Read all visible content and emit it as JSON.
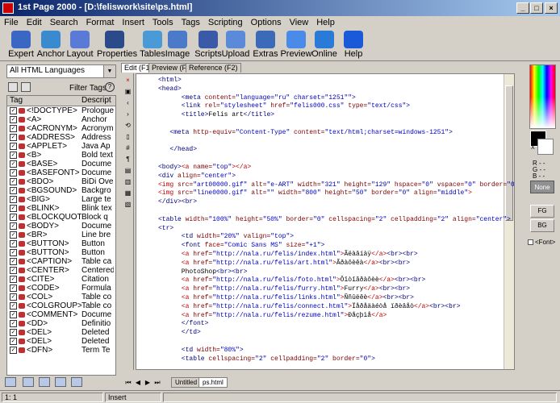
{
  "window": {
    "title": "1st Page 2000 - [D:\\feliswork\\site\\ps.html]",
    "buttons": [
      "_",
      "□",
      "×"
    ]
  },
  "menu": [
    "File",
    "Edit",
    "Search",
    "Format",
    "Insert",
    "Tools",
    "Tags",
    "Scripting",
    "Options",
    "View",
    "Help"
  ],
  "toolbar": [
    {
      "label": "Expert",
      "icon": "expert-icon",
      "color": "#3a66c4"
    },
    {
      "label": "Anchor",
      "icon": "anchor-icon",
      "color": "#3a8ad0"
    },
    {
      "label": "Layout",
      "icon": "layout-icon",
      "color": "#5a7ad8"
    },
    {
      "label": "Properties",
      "icon": "properties-icon",
      "color": "#2a4a8a"
    },
    {
      "label": "Tables",
      "icon": "tables-icon",
      "color": "#4a9ad8"
    },
    {
      "label": "Image",
      "icon": "image-icon",
      "color": "#4a7ac8"
    },
    {
      "label": "Scripts",
      "icon": "scripts-icon",
      "color": "#3a5aa8"
    },
    {
      "label": "Upload",
      "icon": "upload-icon",
      "color": "#5a8ad8"
    },
    {
      "label": "Extras",
      "icon": "extras-icon",
      "color": "#3a6ab8"
    },
    {
      "label": "Preview",
      "icon": "preview-icon",
      "color": "#4a8ae8"
    },
    {
      "label": "Online",
      "icon": "online-icon",
      "color": "#2a7ad8"
    },
    {
      "label": "Help",
      "icon": "help-icon",
      "color": "#1a5ad8"
    }
  ],
  "left": {
    "language_select": "All HTML Languages",
    "filter_label": "Filter Tags",
    "help": "?",
    "columns": [
      "Tag",
      "Descript"
    ],
    "tags": [
      {
        "tag": "<!DOCTYPE>",
        "desc": "Prologue"
      },
      {
        "tag": "<A>",
        "desc": "Anchor"
      },
      {
        "tag": "<ACRONYM>",
        "desc": "Acronym"
      },
      {
        "tag": "<ADDRESS>",
        "desc": "Address"
      },
      {
        "tag": "<APPLET>",
        "desc": "Java Ap"
      },
      {
        "tag": "<B>",
        "desc": "Bold text"
      },
      {
        "tag": "<BASE>",
        "desc": "Docume"
      },
      {
        "tag": "<BASEFONT>",
        "desc": "Docume"
      },
      {
        "tag": "<BDO>",
        "desc": "BiDi Ove"
      },
      {
        "tag": "<BGSOUND>",
        "desc": "Backgro"
      },
      {
        "tag": "<BIG>",
        "desc": "Large te"
      },
      {
        "tag": "<BLINK>",
        "desc": "Blink tex"
      },
      {
        "tag": "<BLOCKQUOTE>",
        "desc": "Block q"
      },
      {
        "tag": "<BODY>",
        "desc": "Docume"
      },
      {
        "tag": "<BR>",
        "desc": "Line bre"
      },
      {
        "tag": "<BUTTON>",
        "desc": "Button"
      },
      {
        "tag": "<BUTTON>",
        "desc": "Button"
      },
      {
        "tag": "<CAPTION>",
        "desc": "Table ca"
      },
      {
        "tag": "<CENTER>",
        "desc": "Centered"
      },
      {
        "tag": "<CITE>",
        "desc": "Citation"
      },
      {
        "tag": "<CODE>",
        "desc": "Formula"
      },
      {
        "tag": "<COL>",
        "desc": "Table co"
      },
      {
        "tag": "<COLGROUP>",
        "desc": "Table co"
      },
      {
        "tag": "<COMMENT>",
        "desc": "Docume"
      },
      {
        "tag": "<DD>",
        "desc": "Definitio"
      },
      {
        "tag": "<DEL>",
        "desc": "Deleted"
      },
      {
        "tag": "<DEL>",
        "desc": "Deleted"
      },
      {
        "tag": "<DFN>",
        "desc": "Term Te"
      }
    ]
  },
  "editor": {
    "tabs": [
      "Edit (F11)",
      "Preview (F12)",
      "Reference (F2)"
    ],
    "doc_tabs": [
      "Untitled",
      "ps.html"
    ],
    "gutter_icons": [
      "×",
      "▣",
      "‹",
      "›",
      "⟲",
      "▯",
      "#",
      "¶",
      "▤",
      "▥",
      "▦",
      "▧"
    ],
    "lines": [
      [
        [
          "c-tag",
          "<html>"
        ]
      ],
      [
        [
          "c-tag",
          "<head>"
        ]
      ],
      [
        [
          "c-tag",
          "      <meta "
        ],
        [
          "c-attr",
          "content="
        ],
        [
          "c-val",
          "\"language=\"ru\" charset=\"1251\"\""
        ],
        [
          "c-tag",
          ">"
        ]
      ],
      [
        [
          "c-tag",
          "      <link "
        ],
        [
          "c-attr",
          "rel="
        ],
        [
          "c-val",
          "\"stylesheet\" "
        ],
        [
          "c-attr",
          "href="
        ],
        [
          "c-val",
          "\"felis000.css\" "
        ],
        [
          "c-attr",
          "type="
        ],
        [
          "c-val",
          "\"text/css\""
        ],
        [
          "c-tag",
          ">"
        ]
      ],
      [
        [
          "c-tag",
          "      <title>"
        ],
        [
          "c-txt",
          "Felis art"
        ],
        [
          "c-tag",
          "</title>"
        ]
      ],
      [
        [
          "c-txt",
          ""
        ]
      ],
      [
        [
          "c-tag",
          "   <meta "
        ],
        [
          "c-attr",
          "http-equiv="
        ],
        [
          "c-val",
          "\"Content-Type\" "
        ],
        [
          "c-attr",
          "content="
        ],
        [
          "c-val",
          "\"text/html;charset=windows-1251\""
        ],
        [
          "c-tag",
          ">"
        ]
      ],
      [
        [
          "c-txt",
          ""
        ]
      ],
      [
        [
          "c-tag",
          "   </head>"
        ]
      ],
      [
        [
          "c-txt",
          ""
        ]
      ],
      [
        [
          "c-tag",
          "<body>"
        ],
        [
          "c-red",
          "<a "
        ],
        [
          "c-attr",
          "name="
        ],
        [
          "c-val",
          "\"top\""
        ],
        [
          "c-red",
          "></a>"
        ]
      ],
      [
        [
          "c-tag",
          "<div "
        ],
        [
          "c-attr",
          "align="
        ],
        [
          "c-val",
          "\"center\""
        ],
        [
          "c-tag",
          ">"
        ]
      ],
      [
        [
          "c-red",
          "<img "
        ],
        [
          "c-attr",
          "src="
        ],
        [
          "c-val",
          "\"art00000.gif\" "
        ],
        [
          "c-attr",
          "alt="
        ],
        [
          "c-val",
          "\"e-ART\" "
        ],
        [
          "c-attr",
          "width="
        ],
        [
          "c-val",
          "\"321\" "
        ],
        [
          "c-attr",
          "height="
        ],
        [
          "c-val",
          "\"129\" "
        ],
        [
          "c-attr",
          "hspace="
        ],
        [
          "c-val",
          "\"0\" "
        ],
        [
          "c-attr",
          "vspace="
        ],
        [
          "c-val",
          "\"0\" "
        ],
        [
          "c-attr",
          "border="
        ],
        [
          "c-val",
          "\"0\""
        ]
      ],
      [
        [
          "c-red",
          "<img "
        ],
        [
          "c-attr",
          "src="
        ],
        [
          "c-val",
          "\"line0000.gif\" "
        ],
        [
          "c-attr",
          "alt="
        ],
        [
          "c-val",
          "\"\" "
        ],
        [
          "c-attr",
          "width="
        ],
        [
          "c-val",
          "\"800\" "
        ],
        [
          "c-attr",
          "height="
        ],
        [
          "c-val",
          "\"50\" "
        ],
        [
          "c-attr",
          "border="
        ],
        [
          "c-val",
          "\"0\" "
        ],
        [
          "c-attr",
          "align="
        ],
        [
          "c-val",
          "\"middle\""
        ],
        [
          "c-red",
          ">"
        ]
      ],
      [
        [
          "c-tag",
          "</div><br>"
        ]
      ],
      [
        [
          "c-txt",
          ""
        ]
      ],
      [
        [
          "c-tag",
          "<table "
        ],
        [
          "c-attr",
          "width="
        ],
        [
          "c-val",
          "\"100%\" "
        ],
        [
          "c-attr",
          "height="
        ],
        [
          "c-val",
          "\"50%\" "
        ],
        [
          "c-attr",
          "border="
        ],
        [
          "c-val",
          "\"0\" "
        ],
        [
          "c-attr",
          "cellspacing="
        ],
        [
          "c-val",
          "\"2\" "
        ],
        [
          "c-attr",
          "cellpadding="
        ],
        [
          "c-val",
          "\"2\" "
        ],
        [
          "c-attr",
          "align="
        ],
        [
          "c-val",
          "\"center\""
        ],
        [
          "c-tag",
          ">"
        ]
      ],
      [
        [
          "c-tag",
          "<tr>"
        ]
      ],
      [
        [
          "c-tag",
          "      <td "
        ],
        [
          "c-attr",
          "width="
        ],
        [
          "c-val",
          "\"20%\" "
        ],
        [
          "c-attr",
          "valign="
        ],
        [
          "c-val",
          "\"top\""
        ],
        [
          "c-tag",
          ">"
        ]
      ],
      [
        [
          "c-tag",
          "      <font "
        ],
        [
          "c-attr",
          "face="
        ],
        [
          "c-val",
          "\"Comic Sans MS\" "
        ],
        [
          "c-attr",
          "size="
        ],
        [
          "c-val",
          "\"+1\""
        ],
        [
          "c-tag",
          ">"
        ]
      ],
      [
        [
          "c-red",
          "      <a "
        ],
        [
          "c-attr",
          "href="
        ],
        [
          "c-val",
          "\"http://nala.ru/felis/index.html\""
        ],
        [
          "c-red",
          ">"
        ],
        [
          "c-txt",
          "Ãëàâíàÿ"
        ],
        [
          "c-red",
          "</a>"
        ],
        [
          "c-tag",
          "<br><br>"
        ]
      ],
      [
        [
          "c-red",
          "      <a "
        ],
        [
          "c-attr",
          "href="
        ],
        [
          "c-val",
          "\"http://nala.ru/felis/art.html\""
        ],
        [
          "c-red",
          ">"
        ],
        [
          "c-txt",
          "Ãðàôèêà"
        ],
        [
          "c-red",
          "</a>"
        ],
        [
          "c-tag",
          "<br><br>"
        ]
      ],
      [
        [
          "c-txt",
          "      PhotoShop"
        ],
        [
          "c-tag",
          "<br><br>"
        ]
      ],
      [
        [
          "c-red",
          "      <a "
        ],
        [
          "c-attr",
          "href="
        ],
        [
          "c-val",
          "\"http://nala.ru/felis/foto.html\""
        ],
        [
          "c-red",
          ">"
        ],
        [
          "c-txt",
          "Ôîòîãðàôèè"
        ],
        [
          "c-red",
          "</a>"
        ],
        [
          "c-tag",
          "<br><br>"
        ]
      ],
      [
        [
          "c-red",
          "      <a "
        ],
        [
          "c-attr",
          "href="
        ],
        [
          "c-val",
          "\"http://nala.ru/felis/furry.html\""
        ],
        [
          "c-red",
          ">"
        ],
        [
          "c-txt",
          "Furry"
        ],
        [
          "c-red",
          "</a>"
        ],
        [
          "c-tag",
          "<br><br>"
        ]
      ],
      [
        [
          "c-red",
          "      <a "
        ],
        [
          "c-attr",
          "href="
        ],
        [
          "c-val",
          "\"http://nala.ru/felis/links.html\""
        ],
        [
          "c-red",
          ">"
        ],
        [
          "c-txt",
          "Ññûëêè"
        ],
        [
          "c-red",
          "</a>"
        ],
        [
          "c-tag",
          "<br><br>"
        ]
      ],
      [
        [
          "c-red",
          "      <a "
        ],
        [
          "c-attr",
          "href="
        ],
        [
          "c-val",
          "\"http://nala.ru/felis/connect.html\""
        ],
        [
          "c-red",
          ">"
        ],
        [
          "c-txt",
          "Ïåðåäàéòå ïðèâåò"
        ],
        [
          "c-red",
          "</a>"
        ],
        [
          "c-tag",
          "<br><br>"
        ]
      ],
      [
        [
          "c-red",
          "      <a "
        ],
        [
          "c-attr",
          "href="
        ],
        [
          "c-val",
          "\"http://nala.ru/felis/rezume.html\""
        ],
        [
          "c-red",
          ">"
        ],
        [
          "c-txt",
          "Ðåçþìå"
        ],
        [
          "c-red",
          "</a>"
        ]
      ],
      [
        [
          "c-tag",
          "      </font>"
        ]
      ],
      [
        [
          "c-tag",
          "      </td>"
        ]
      ],
      [
        [
          "c-txt",
          ""
        ]
      ],
      [
        [
          "c-tag",
          "      <td "
        ],
        [
          "c-attr",
          "width="
        ],
        [
          "c-val",
          "\"80%\""
        ],
        [
          "c-tag",
          ">"
        ]
      ],
      [
        [
          "c-tag",
          "      <table "
        ],
        [
          "c-attr",
          "cellspacing="
        ],
        [
          "c-val",
          "\"2\" "
        ],
        [
          "c-attr",
          "cellpadding="
        ],
        [
          "c-val",
          "\"2\" "
        ],
        [
          "c-attr",
          "border="
        ],
        [
          "c-val",
          "\"0\""
        ],
        [
          "c-tag",
          ">"
        ]
      ]
    ]
  },
  "status": {
    "position": "1:    1",
    "mode": "Insert"
  },
  "right": {
    "x_label": "X",
    "rgb": [
      "R - -",
      "G - -",
      "B - -"
    ],
    "none": "None",
    "fg": "FG",
    "bg": "BG",
    "font": "<Font>"
  }
}
